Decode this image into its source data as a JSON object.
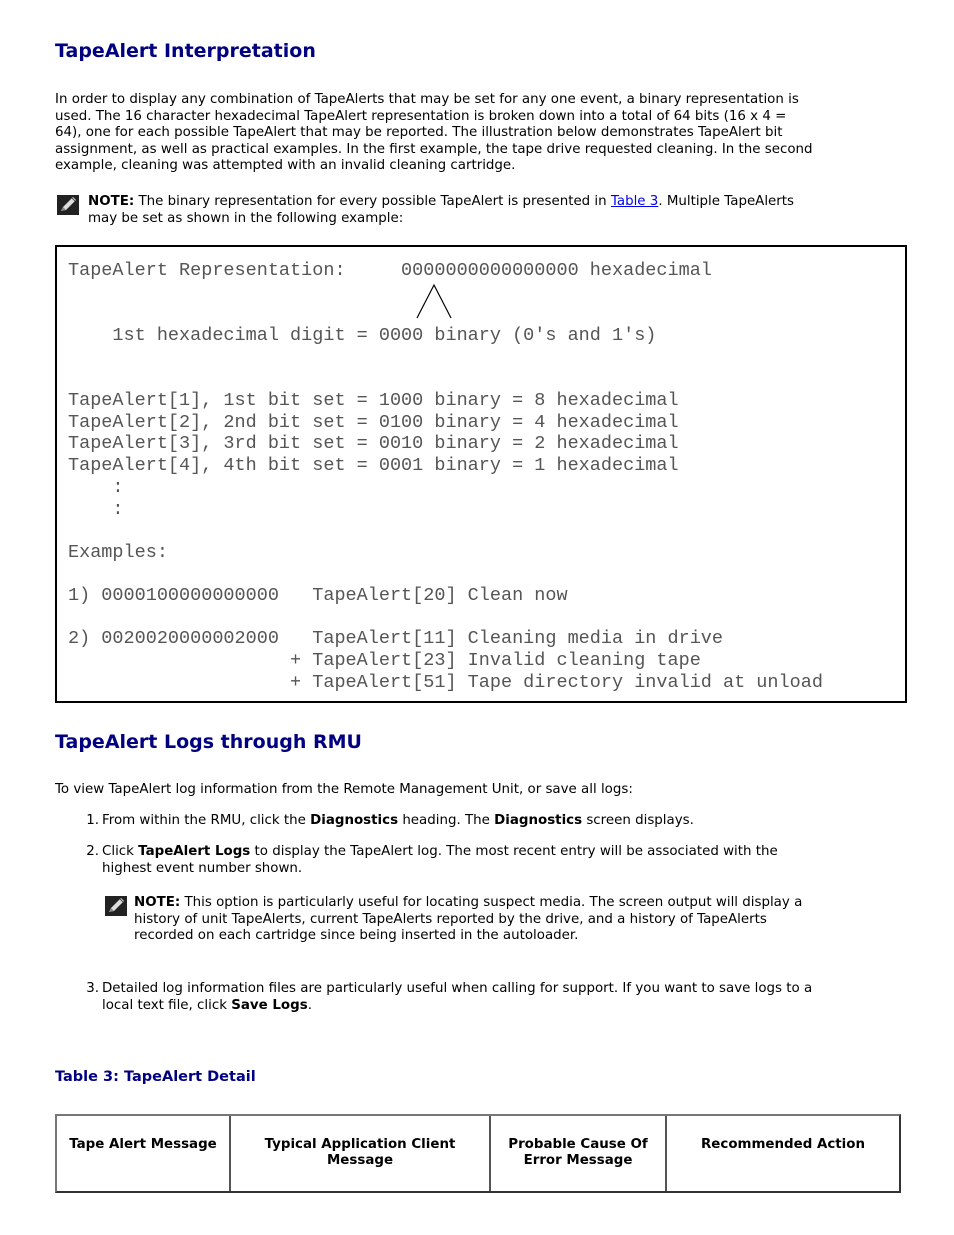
{
  "section1": {
    "heading": "TapeAlert Interpretation",
    "paragraph_lines": [
      "In order to display any combination of TapeAlerts that may be set for any one event, a binary representation is",
      "used. The 16 character hexadecimal TapeAlert representation is broken down into a total of 64 bits (16 x 4 =",
      "64), one for each possible TapeAlert that may be reported. The illustration below demonstrates TapeAlert bit",
      "assignment, as well as practical examples. In the first example, the tape drive requested cleaning. In the second",
      "example, cleaning was attempted with an invalid cleaning cartridge."
    ],
    "note": {
      "icon": "pencil-note-icon",
      "label": "NOTE:",
      "text_before_link": " The binary representation for every possible TapeAlert is presented in ",
      "link_text": "Table 3",
      "text_after_link": ". Multiple TapeAlerts",
      "text_line2": "may be set as shown in the following example:"
    }
  },
  "figure": {
    "lines": [
      "TapeAlert Representation:     0000000000000000 hexadecimal",
      "    1st hexadecimal digit = 0000 binary (0's and 1's)",
      "TapeAlert[1], 1st bit set = 1000 binary = 8 hexadecimal",
      "TapeAlert[2], 2nd bit set = 0100 binary = 4 hexadecimal",
      "TapeAlert[3], 3rd bit set = 0010 binary = 2 hexadecimal",
      "TapeAlert[4], 4th bit set = 0001 binary = 1 hexadecimal",
      "    :",
      "    :",
      "Examples:",
      "1) 0000100000000000   TapeAlert[20] Clean now",
      "2) 0020020000002000   TapeAlert[11] Cleaning media in drive",
      "                    + TapeAlert[23] Invalid cleaning tape",
      "                    + TapeAlert[51] Tape directory invalid at unload"
    ]
  },
  "section2": {
    "heading": "TapeAlert Logs through RMU",
    "intro": "To view TapeAlert log information from the Remote Management Unit, or save all logs:",
    "steps": [
      {
        "num": "1.",
        "parts": [
          "From within the RMU, click the ",
          "Diagnostics",
          " heading. The ",
          "Diagnostics",
          " screen displays."
        ]
      },
      {
        "num": "2.",
        "parts": [
          "Click ",
          "TapeAlert Logs",
          " to display the TapeAlert log. The most recent entry will be associated with the"
        ],
        "line2": "highest event number shown.",
        "note": {
          "icon": "pencil-note-icon",
          "label": "NOTE:",
          "lines": [
            " This option is particularly useful for locating suspect media. The screen output will display a",
            "history of unit TapeAlerts, current TapeAlerts reported by the drive, and a history of TapeAlerts",
            "recorded on each cartridge since being inserted in the autoloader."
          ]
        }
      },
      {
        "num": "3.",
        "line1": "Detailed log information files are particularly useful when calling for support. If you want to save logs to a",
        "parts2": [
          "local text file, click ",
          "Save Logs",
          "."
        ]
      }
    ]
  },
  "table3": {
    "caption": "Table 3: TapeAlert Detail",
    "headers": [
      "Tape Alert Message",
      "Typical Application Client Message",
      "Probable Cause Of Error Message",
      "Recommended Action"
    ]
  }
}
